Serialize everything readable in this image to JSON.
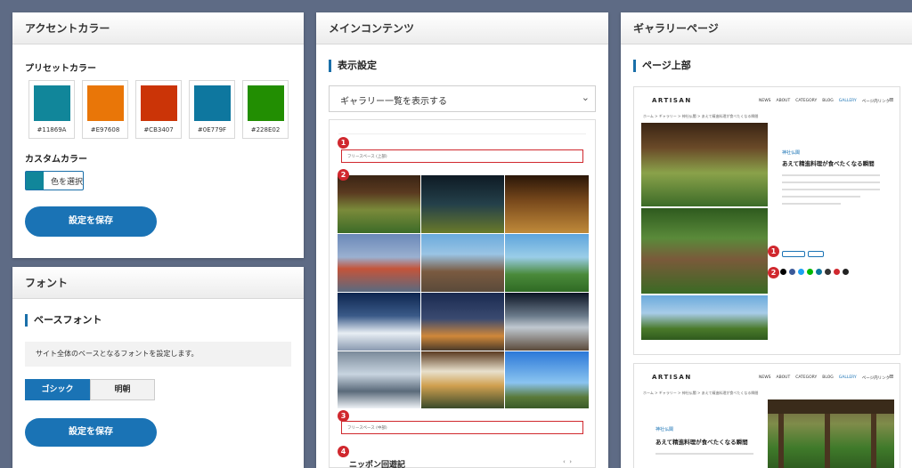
{
  "accent": {
    "title": "アクセントカラー",
    "preset_label": "プリセットカラー",
    "swatches": [
      {
        "hex": "#11869A",
        "color": "#11869A"
      },
      {
        "hex": "#E97608",
        "color": "#E97608"
      },
      {
        "hex": "#CB3407",
        "color": "#CB3407"
      },
      {
        "hex": "#0E779F",
        "color": "#0E779F"
      },
      {
        "hex": "#228E02",
        "color": "#228E02"
      }
    ],
    "custom_label": "カスタムカラー",
    "select_label": "色を選択",
    "save_label": "設定を保存"
  },
  "font": {
    "title": "フォント",
    "section": "ベースフォント",
    "desc": "サイト全体のベースとなるフォントを設定します。",
    "gothic": "ゴシック",
    "mincho": "明朝",
    "save_label": "設定を保存"
  },
  "main": {
    "title": "メインコンテンツ",
    "section": "表示設定",
    "select_value": "ギャラリー一覧を表示する",
    "preview": {
      "top_text": "フリースペース (上部)",
      "mid_text": "フリースペース (中部)",
      "bottom_title": "ニッポン回遊記",
      "badges": [
        "1",
        "2",
        "3",
        "4"
      ]
    }
  },
  "gallery": {
    "title": "ギャラリーページ",
    "section": "ページ上部",
    "logo": "ARTISAN",
    "nav": [
      "NEWS",
      "ABOUT",
      "CATEGORY",
      "BLOG",
      "GALLERY",
      "ページ内リンク"
    ],
    "breadcrumb": "ホーム > ギャラリー > 神社仏閣 > あえて精進料理が食べたくなる瞬間",
    "category": "神社仏閣",
    "article_title": "あえて精進料理が食べたくなる瞬間",
    "badges": [
      "1",
      "2"
    ],
    "share_colors": [
      "#000000",
      "#3b5998",
      "#1da1f2",
      "#00b900",
      "#0e779f",
      "#333333",
      "#d0282e",
      "#222222"
    ]
  }
}
